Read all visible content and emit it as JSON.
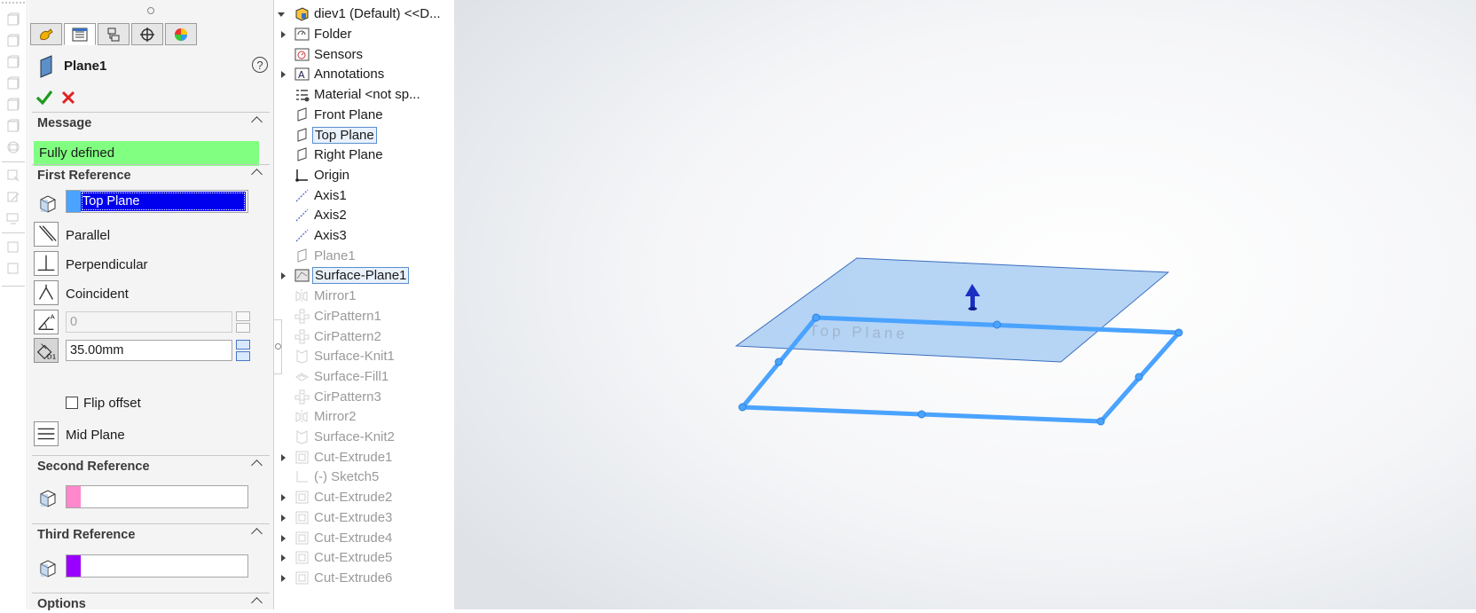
{
  "property_manager": {
    "feature_name": "Plane1",
    "help_label": "?",
    "tabs": [
      "feature-manager",
      "property-manager",
      "configuration-manager",
      "dimxpert-manager",
      "display-manager"
    ],
    "message": {
      "header": "Message",
      "text": "Fully defined",
      "color": "#80ff80"
    },
    "first_reference": {
      "header": "First Reference",
      "value": "Top Plane",
      "swatch_color": "#4aa3ff",
      "constraints": {
        "parallel": "Parallel",
        "perpendicular": "Perpendicular",
        "coincident": "Coincident",
        "angle_value": "0",
        "offset_value": "35.00mm",
        "flip_offset": "Flip offset",
        "mid_plane": "Mid Plane"
      }
    },
    "second_reference": {
      "header": "Second Reference",
      "value": "",
      "swatch_color": "#ff88cc"
    },
    "third_reference": {
      "header": "Third Reference",
      "value": "",
      "swatch_color": "#9900ff"
    },
    "options": {
      "header": "Options"
    }
  },
  "feature_tree": {
    "root": "diev1 (Default) <<D...",
    "items": [
      {
        "label": "Folder",
        "icon": "folder-icon",
        "expandable": true,
        "dim": false
      },
      {
        "label": "Sensors",
        "icon": "sensors-icon",
        "expandable": false,
        "dim": false
      },
      {
        "label": "Annotations",
        "icon": "annotations-icon",
        "expandable": true,
        "dim": false
      },
      {
        "label": "Material <not sp...",
        "icon": "material-icon",
        "expandable": false,
        "dim": false
      },
      {
        "label": "Front Plane",
        "icon": "plane-icon",
        "expandable": false,
        "dim": false
      },
      {
        "label": "Top Plane",
        "icon": "plane-icon",
        "expandable": false,
        "dim": false,
        "selected": true
      },
      {
        "label": "Right Plane",
        "icon": "plane-icon",
        "expandable": false,
        "dim": false
      },
      {
        "label": "Origin",
        "icon": "origin-icon",
        "expandable": false,
        "dim": false
      },
      {
        "label": "Axis1",
        "icon": "axis-icon",
        "expandable": false,
        "dim": false
      },
      {
        "label": "Axis2",
        "icon": "axis-icon",
        "expandable": false,
        "dim": false
      },
      {
        "label": "Axis3",
        "icon": "axis-icon",
        "expandable": false,
        "dim": false
      },
      {
        "label": "Plane1",
        "icon": "plane-icon",
        "expandable": false,
        "dim": true
      },
      {
        "label": "Surface-Plane1",
        "icon": "surface-plane-icon",
        "expandable": true,
        "dim": false,
        "selected": true
      },
      {
        "label": "Mirror1",
        "icon": "mirror-icon",
        "expandable": false,
        "dim": true
      },
      {
        "label": "CirPattern1",
        "icon": "circular-pattern-icon",
        "expandable": false,
        "dim": true
      },
      {
        "label": "CirPattern2",
        "icon": "circular-pattern-icon",
        "expandable": false,
        "dim": true
      },
      {
        "label": "Surface-Knit1",
        "icon": "surface-knit-icon",
        "expandable": false,
        "dim": true
      },
      {
        "label": "Surface-Fill1",
        "icon": "surface-fill-icon",
        "expandable": false,
        "dim": true
      },
      {
        "label": "CirPattern3",
        "icon": "circular-pattern-icon",
        "expandable": false,
        "dim": true
      },
      {
        "label": "Mirror2",
        "icon": "mirror-icon",
        "expandable": false,
        "dim": true
      },
      {
        "label": "Surface-Knit2",
        "icon": "surface-knit-icon",
        "expandable": false,
        "dim": true
      },
      {
        "label": "Cut-Extrude1",
        "icon": "cut-extrude-icon",
        "expandable": true,
        "dim": true
      },
      {
        "label": "(-) Sketch5",
        "icon": "sketch-icon",
        "expandable": false,
        "dim": true
      },
      {
        "label": "Cut-Extrude2",
        "icon": "cut-extrude-icon",
        "expandable": true,
        "dim": true
      },
      {
        "label": "Cut-Extrude3",
        "icon": "cut-extrude-icon",
        "expandable": true,
        "dim": true
      },
      {
        "label": "Cut-Extrude4",
        "icon": "cut-extrude-icon",
        "expandable": true,
        "dim": true
      },
      {
        "label": "Cut-Extrude5",
        "icon": "cut-extrude-icon",
        "expandable": true,
        "dim": true
      },
      {
        "label": "Cut-Extrude6",
        "icon": "cut-extrude-icon",
        "expandable": true,
        "dim": true
      }
    ]
  },
  "viewport": {
    "plane_label": "Top Plane",
    "plane_fill": "#a9cdf2",
    "preview_color": "#4aa3ff"
  }
}
